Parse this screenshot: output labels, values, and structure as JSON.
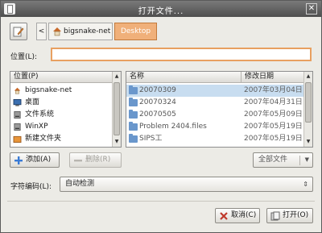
{
  "window": {
    "title": "打开文件..."
  },
  "path_bar": {
    "back_glyph": "<",
    "crumbs": [
      {
        "label": "bigsnake-net",
        "icon": "home-icon"
      },
      {
        "label": "Desktop",
        "icon": "none",
        "active": true
      }
    ]
  },
  "location": {
    "label": "位置(L):",
    "value": "",
    "placeholder": ""
  },
  "places": {
    "header": "位置(P)",
    "items": [
      {
        "label": "bigsnake-net",
        "icon": "home-icon"
      },
      {
        "label": "桌面",
        "icon": "desktop-icon"
      },
      {
        "label": "文件系统",
        "icon": "harddisk-icon"
      },
      {
        "label": "WinXP",
        "icon": "harddisk-icon"
      },
      {
        "label": "新建文件夹",
        "icon": "folder-orange-icon"
      }
    ]
  },
  "files": {
    "name_header": "名称",
    "date_header": "修改日期",
    "rows": [
      {
        "name": "20070309",
        "date": "2007年03月04日",
        "selected": true,
        "icon": "folder-icon"
      },
      {
        "name": "20070324",
        "date": "2007年04月31日",
        "selected": false,
        "icon": "folder-icon"
      },
      {
        "name": "20070505",
        "date": "2007年05月09日",
        "selected": false,
        "icon": "folder-icon"
      },
      {
        "name": "Problem 2404.files",
        "date": "2007年05月19日",
        "selected": false,
        "icon": "folder-icon"
      },
      {
        "name": "SIPS工",
        "date": "2007年05月19日",
        "selected": false,
        "icon": "folder-icon"
      }
    ]
  },
  "buttons": {
    "add": "添加(A)",
    "remove": "删除(R)",
    "cancel": "取消(C)",
    "open": "打开(O)"
  },
  "filter": {
    "value": "全部文件"
  },
  "encoding": {
    "label": "字符编码(L):",
    "value": "自动检测"
  },
  "colors": {
    "accent": "#f0b07a",
    "selection": "#c8ddf0",
    "titlebar": "#5a5a5a"
  }
}
